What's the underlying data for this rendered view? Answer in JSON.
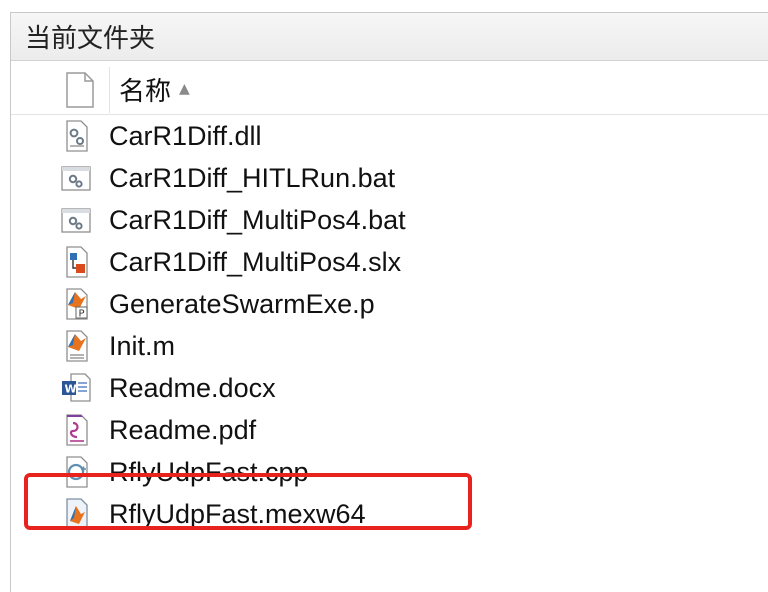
{
  "panel": {
    "title": "当前文件夹",
    "column_header": {
      "name_label": "名称",
      "sort_indicator": "▲",
      "icon": "blank-file-icon"
    }
  },
  "files": [
    {
      "name": "CarR1Diff.dll",
      "icon": "dll-gear-icon"
    },
    {
      "name": "CarR1Diff_HITLRun.bat",
      "icon": "batch-gear-icon"
    },
    {
      "name": "CarR1Diff_MultiPos4.bat",
      "icon": "batch-gear-icon"
    },
    {
      "name": "CarR1Diff_MultiPos4.slx",
      "icon": "simulink-model-icon"
    },
    {
      "name": "GenerateSwarmExe.p",
      "icon": "matlab-p-file-icon"
    },
    {
      "name": "Init.m",
      "icon": "matlab-m-file-icon"
    },
    {
      "name": "Readme.docx",
      "icon": "word-document-icon"
    },
    {
      "name": "Readme.pdf",
      "icon": "pdf-document-icon"
    },
    {
      "name": "RflyUdpFast.cpp",
      "icon": "cpp-source-icon"
    },
    {
      "name": "RflyUdpFast.mexw64",
      "icon": "matlab-mex-file-icon"
    }
  ],
  "highlight": {
    "color": "#e8221c",
    "target_file": "RflyUdpFast.mexw64"
  }
}
